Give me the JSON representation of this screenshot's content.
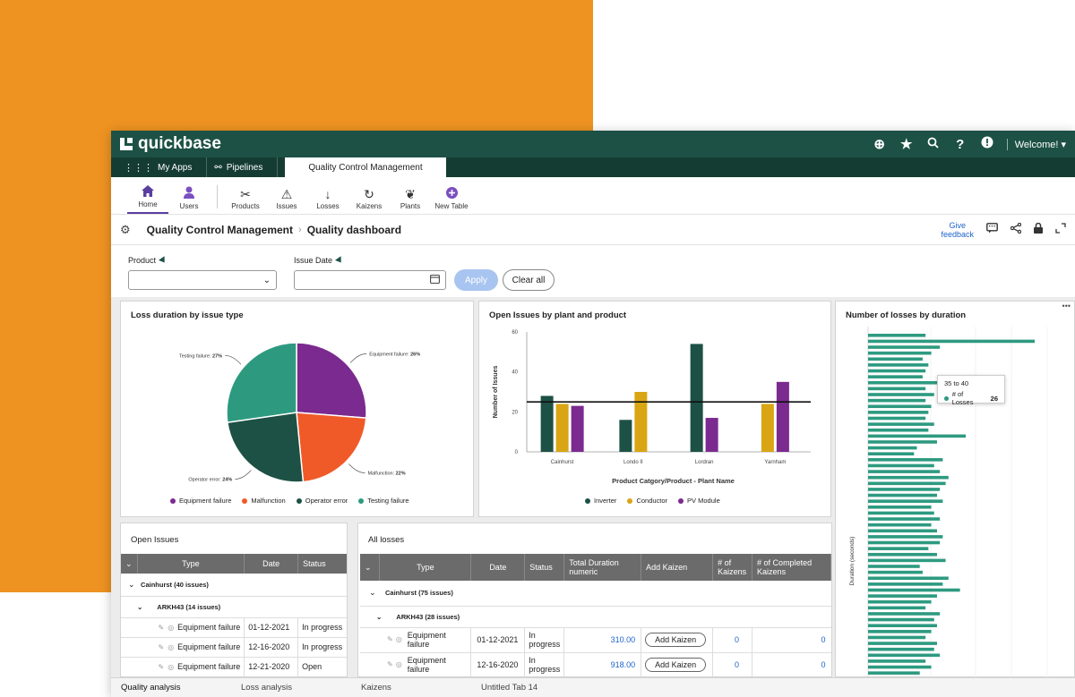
{
  "app": {
    "brand": "quickbase",
    "welcome": "Welcome!"
  },
  "tabs": [
    {
      "label": "My Apps",
      "icon": "grid-icon"
    },
    {
      "label": "Pipelines",
      "icon": "pipeline-icon"
    },
    {
      "label": "Quality Control Management",
      "active": true
    }
  ],
  "nav": [
    {
      "label": "Home",
      "icon": "home-icon",
      "active": true
    },
    {
      "label": "Users",
      "icon": "users-icon"
    },
    {
      "label": "Products",
      "icon": "tools-icon"
    },
    {
      "label": "Issues",
      "icon": "warning-icon"
    },
    {
      "label": "Losses",
      "icon": "arrow-down-icon"
    },
    {
      "label": "Kaizens",
      "icon": "refresh-icon"
    },
    {
      "label": "Plants",
      "icon": "leaf-icon"
    },
    {
      "label": "New Table",
      "icon": "plus-circle-icon"
    }
  ],
  "breadcrumb": {
    "app": "Quality Control Management",
    "page": "Quality dashboard",
    "feedback_line1": "Give",
    "feedback_line2": "feedback"
  },
  "filters": {
    "product_label": "Product",
    "date_label": "Issue Date",
    "apply": "Apply",
    "clear": "Clear all"
  },
  "pie": {
    "title": "Loss duration by issue type",
    "chart_data": {
      "type": "pie",
      "slices": [
        {
          "name": "Equipment failure",
          "value": 26,
          "label": "Equipment failure: 26%",
          "color": "#7b2a8f"
        },
        {
          "name": "Malfunction",
          "value": 22,
          "label": "Malfunction: 22%",
          "color": "#f05a28"
        },
        {
          "name": "Operator error",
          "value": 24,
          "label": "Operator error: 24%",
          "color": "#1d5145"
        },
        {
          "name": "Testing failure",
          "value": 27,
          "label": "Testing failure: 27%",
          "color": "#2d9a80"
        }
      ]
    }
  },
  "bar": {
    "title": "Open Issues by plant and product",
    "chart_data": {
      "type": "bar",
      "categories": [
        "Cainhurst",
        "Londo II",
        "Lordran",
        "Yarnham"
      ],
      "series": [
        {
          "name": "Inverter",
          "color": "#1d5145",
          "values": [
            28,
            16,
            54,
            null
          ]
        },
        {
          "name": "Conductor",
          "color": "#d9a514",
          "values": [
            24,
            30,
            null,
            24
          ]
        },
        {
          "name": "PV Module",
          "color": "#7b2a8f",
          "values": [
            23,
            null,
            17,
            35
          ]
        }
      ],
      "reference_line": 25,
      "ylabel": "Number of Issues",
      "xlabel": "Product Catgory/Product - Plant Name",
      "yticks": [
        0,
        20,
        40,
        60
      ],
      "ylim": [
        0,
        60
      ]
    }
  },
  "hbar": {
    "title": "Number of losses by duration",
    "ylabel": "Duration (seconds)",
    "tooltip_range": "35 to 40",
    "tooltip_series": "# of Losses",
    "tooltip_value": "26",
    "more": "•••",
    "chart_data": {
      "type": "bar",
      "orientation": "horizontal",
      "values": [
        20,
        58,
        25,
        22,
        19,
        21,
        20,
        19,
        26,
        20,
        23,
        20,
        22,
        21,
        20,
        23,
        21,
        34,
        24,
        17,
        16,
        26,
        23,
        25,
        28,
        27,
        25,
        24,
        26,
        22,
        23,
        25,
        22,
        24,
        26,
        25,
        21,
        24,
        27,
        18,
        19,
        28,
        26,
        32,
        24,
        22,
        20,
        25,
        23,
        24,
        22,
        20,
        24,
        23,
        25,
        20,
        22,
        18
      ],
      "xlim": [
        0,
        58
      ],
      "highlight": {
        "range": "35 to 40",
        "value": 26
      }
    }
  },
  "open_issues": {
    "title": "Open Issues",
    "columns": [
      "Type",
      "Date",
      "Status"
    ],
    "group": "Cainhurst (40 issues)",
    "subgroup": "ARKH43 (14 issues)",
    "rows": [
      {
        "type": "Equipment failure",
        "date": "01-12-2021",
        "status": "In progress"
      },
      {
        "type": "Equipment failure",
        "date": "12-16-2020",
        "status": "In progress"
      },
      {
        "type": "Equipment failure",
        "date": "12-21-2020",
        "status": "Open"
      }
    ]
  },
  "all_losses": {
    "title": "All losses",
    "columns": [
      "Type",
      "Date",
      "Status",
      "Total Duration numeric",
      "Add Kaizen",
      "# of Kaizens",
      "# of Completed Kaizens"
    ],
    "group": "Cainhurst (75 issues)",
    "subgroup": "ARKH43 (28 issues)",
    "rows": [
      {
        "type": "Equipment failure",
        "date": "01-12-2021",
        "status": "In progress",
        "duration": "310.00",
        "kaizen_btn": "Add Kaizen",
        "kaizens": "0",
        "completed": "0"
      },
      {
        "type": "Equipment failure",
        "date": "12-16-2020",
        "status": "In progress",
        "duration": "918.00",
        "kaizen_btn": "Add Kaizen",
        "kaizens": "0",
        "completed": "0"
      }
    ]
  },
  "bottom_tabs": [
    "Quality analysis",
    "Loss analysis",
    "Kaizens",
    "Untitled Tab 14"
  ]
}
